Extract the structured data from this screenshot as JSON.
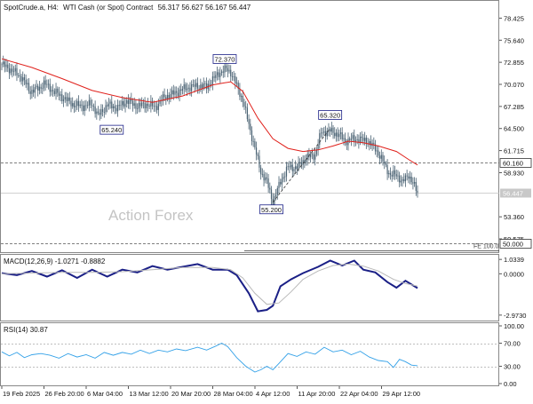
{
  "header": {
    "symbol": "SpotCrude.a, H4:",
    "description": "WTI Cash (or Spot) Contract",
    "ohlc": "56.317 56.627 56.167 56.447"
  },
  "watermark": "Action Forex",
  "colors": {
    "candle": "#4a6273",
    "ma": "#e0201b",
    "macd_main": "#1a1f86",
    "macd_signal": "#b8b8b8",
    "rsi": "#33a1e8",
    "label_border": "#1a1f86",
    "current_price_tag": "#c8c8c8",
    "dashed_line": "#555555"
  },
  "chart_data": [
    {
      "type": "candlestick",
      "name": "price",
      "y_axis_ticks": [
        "78.425",
        "75.640",
        "72.855",
        "70.070",
        "67.285",
        "64.500",
        "61.715",
        "58.930",
        "56.447",
        "53.360",
        "50.575",
        "50.000"
      ],
      "ylim": [
        48.9,
        80.6
      ],
      "x_axis_ticks": [
        "19 Feb 2025",
        "26 Feb 20:00",
        "6 Mar 04:00",
        "13 Mar 12:00",
        "20 Mar 20:00",
        "28 Mar 04:00",
        "4 Apr 12:00",
        "11 Apr 20:00",
        "22 Apr 04:00",
        "29 Apr 12:00"
      ],
      "close_path": [
        [
          0,
          72.6
        ],
        [
          7,
          71.8
        ],
        [
          13,
          71.0
        ],
        [
          19,
          69.2
        ],
        [
          25,
          69.6
        ],
        [
          28,
          70.2
        ],
        [
          36,
          69.0
        ],
        [
          42,
          68.2
        ],
        [
          48,
          67.5
        ],
        [
          54,
          67.3
        ],
        [
          60,
          67.6
        ],
        [
          64,
          66.1
        ],
        [
          70,
          67.5
        ],
        [
          77,
          67.1
        ],
        [
          83,
          68.0
        ],
        [
          90,
          67.3
        ],
        [
          96,
          67.6
        ],
        [
          102,
          67.2
        ],
        [
          108,
          68.5
        ],
        [
          114,
          68.9
        ],
        [
          122,
          69.6
        ],
        [
          130,
          69.9
        ],
        [
          136,
          69.8
        ],
        [
          144,
          71.5
        ],
        [
          149,
          72.0
        ],
        [
          152,
          71.6
        ],
        [
          155,
          70.3
        ],
        [
          160,
          68.1
        ],
        [
          164,
          65.0
        ],
        [
          168,
          62.0
        ],
        [
          172,
          59.0
        ],
        [
          176,
          57.8
        ],
        [
          180,
          55.2
        ],
        [
          185,
          57.8
        ],
        [
          190,
          59.6
        ],
        [
          196,
          59.6
        ],
        [
          202,
          60.8
        ],
        [
          208,
          61.2
        ],
        [
          212,
          64.0
        ],
        [
          218,
          64.2
        ],
        [
          224,
          63.7
        ],
        [
          228,
          62.9
        ],
        [
          234,
          63.2
        ],
        [
          242,
          63.0
        ],
        [
          248,
          62.0
        ],
        [
          254,
          60.0
        ],
        [
          258,
          58.6
        ],
        [
          262,
          58.7
        ],
        [
          266,
          57.7
        ],
        [
          270,
          58.7
        ],
        [
          276,
          56.4
        ]
      ],
      "moving_average": [
        [
          0,
          73.3
        ],
        [
          20,
          72.2
        ],
        [
          40,
          70.8
        ],
        [
          60,
          69.3
        ],
        [
          80,
          68.4
        ],
        [
          100,
          67.8
        ],
        [
          120,
          68.6
        ],
        [
          140,
          70.0
        ],
        [
          152,
          70.4
        ],
        [
          160,
          69.2
        ],
        [
          170,
          65.8
        ],
        [
          180,
          63.2
        ],
        [
          190,
          62.0
        ],
        [
          200,
          61.6
        ],
        [
          210,
          61.8
        ],
        [
          220,
          62.3
        ],
        [
          230,
          62.9
        ],
        [
          240,
          62.7
        ],
        [
          250,
          62.3
        ],
        [
          262,
          61.6
        ],
        [
          270,
          60.6
        ],
        [
          276,
          59.9
        ]
      ],
      "horizontal_levels": [
        {
          "value": 60.16,
          "label": "60.160",
          "style": "dashed"
        },
        {
          "value": 56.447,
          "label": "56.447",
          "style": "solid-gray",
          "current_price": true
        },
        {
          "value": 50.0,
          "label": "50.000",
          "style": "dashed"
        }
      ],
      "fe_level": {
        "value": 49.1,
        "label": "FE 100.0"
      },
      "annotations": [
        {
          "text": "72.370",
          "x": 148,
          "y": 72.37
        },
        {
          "text": "65.240",
          "x": 73,
          "y": 65.24
        },
        {
          "text": "55.200",
          "x": 179,
          "y": 55.2
        },
        {
          "text": "65.320",
          "x": 218,
          "y": 65.32
        }
      ],
      "trendline": {
        "from": [
          180,
          55.2
        ],
        "to": [
          218,
          64.5
        ]
      }
    },
    {
      "type": "line",
      "name": "macd",
      "label": "MACD(12,26,9) -1.0271 -0.8882",
      "y_axis_ticks": [
        "1.0339",
        "0.0000",
        "-2.9730"
      ],
      "ylim": [
        -3.3,
        1.3
      ],
      "series": [
        {
          "role": "main",
          "values": [
            [
              0,
              0.05
            ],
            [
              10,
              -0.1
            ],
            [
              20,
              0.2
            ],
            [
              30,
              -0.2
            ],
            [
              40,
              0.25
            ],
            [
              50,
              -0.3
            ],
            [
              60,
              0.3
            ],
            [
              70,
              -0.2
            ],
            [
              80,
              0.3
            ],
            [
              90,
              0.1
            ],
            [
              100,
              0.55
            ],
            [
              110,
              0.3
            ],
            [
              120,
              0.5
            ],
            [
              130,
              0.7
            ],
            [
              140,
              0.3
            ],
            [
              150,
              0.3
            ],
            [
              156,
              -0.1
            ],
            [
              164,
              -1.4
            ],
            [
              170,
              -2.7
            ],
            [
              176,
              -2.6
            ],
            [
              180,
              -2.3
            ],
            [
              185,
              -0.9
            ],
            [
              192,
              -0.4
            ],
            [
              200,
              0.05
            ],
            [
              210,
              0.5
            ],
            [
              218,
              0.95
            ],
            [
              226,
              0.6
            ],
            [
              234,
              0.95
            ],
            [
              240,
              0.3
            ],
            [
              248,
              0.1
            ],
            [
              256,
              -0.6
            ],
            [
              262,
              -1.0
            ],
            [
              268,
              -0.5
            ],
            [
              276,
              -1.03
            ]
          ]
        },
        {
          "role": "signal",
          "values": [
            [
              0,
              0.0
            ],
            [
              20,
              0.05
            ],
            [
              40,
              0.1
            ],
            [
              60,
              0.1
            ],
            [
              80,
              0.15
            ],
            [
              100,
              0.3
            ],
            [
              120,
              0.45
            ],
            [
              140,
              0.45
            ],
            [
              152,
              0.3
            ],
            [
              160,
              -0.3
            ],
            [
              168,
              -1.4
            ],
            [
              176,
              -2.2
            ],
            [
              184,
              -2.1
            ],
            [
              192,
              -1.3
            ],
            [
              200,
              -0.4
            ],
            [
              210,
              0.2
            ],
            [
              220,
              0.6
            ],
            [
              230,
              0.7
            ],
            [
              240,
              0.55
            ],
            [
              250,
              0.2
            ],
            [
              260,
              -0.4
            ],
            [
              268,
              -0.7
            ],
            [
              276,
              -0.89
            ]
          ]
        }
      ]
    },
    {
      "type": "line",
      "name": "rsi",
      "label": "RSI(14) 30.87",
      "y_axis_ticks": [
        "100.00",
        "70.00",
        "30.00",
        "0.00"
      ],
      "ylim": [
        0,
        100
      ],
      "levels": [
        70,
        30
      ],
      "values": [
        [
          0,
          55
        ],
        [
          5,
          48
        ],
        [
          10,
          54
        ],
        [
          15,
          45
        ],
        [
          20,
          50
        ],
        [
          26,
          52
        ],
        [
          32,
          49
        ],
        [
          38,
          44
        ],
        [
          44,
          52
        ],
        [
          50,
          46
        ],
        [
          56,
          50
        ],
        [
          62,
          44
        ],
        [
          68,
          54
        ],
        [
          74,
          49
        ],
        [
          80,
          54
        ],
        [
          86,
          51
        ],
        [
          92,
          58
        ],
        [
          98,
          52
        ],
        [
          104,
          58
        ],
        [
          110,
          55
        ],
        [
          116,
          60
        ],
        [
          122,
          57
        ],
        [
          130,
          63
        ],
        [
          136,
          58
        ],
        [
          142,
          65
        ],
        [
          146,
          70
        ],
        [
          150,
          64
        ],
        [
          156,
          45
        ],
        [
          162,
          30
        ],
        [
          168,
          20
        ],
        [
          172,
          24
        ],
        [
          176,
          30
        ],
        [
          180,
          24
        ],
        [
          184,
          35
        ],
        [
          190,
          52
        ],
        [
          196,
          47
        ],
        [
          202,
          55
        ],
        [
          208,
          51
        ],
        [
          214,
          63
        ],
        [
          220,
          55
        ],
        [
          226,
          58
        ],
        [
          232,
          50
        ],
        [
          238,
          56
        ],
        [
          244,
          46
        ],
        [
          250,
          40
        ],
        [
          256,
          38
        ],
        [
          260,
          28
        ],
        [
          264,
          42
        ],
        [
          268,
          38
        ],
        [
          272,
          32
        ],
        [
          276,
          30.87
        ]
      ]
    }
  ]
}
